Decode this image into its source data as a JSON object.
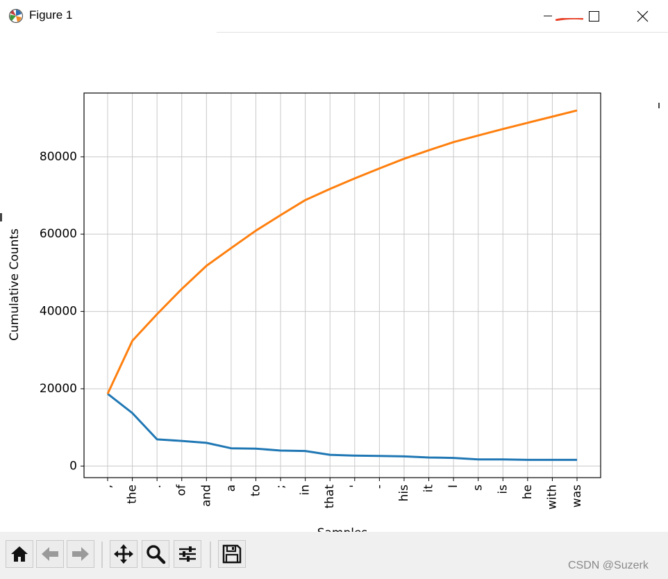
{
  "window": {
    "title": "Figure 1",
    "minimize_icon": "minimize-icon",
    "maximize_icon": "maximize-icon",
    "close_icon": "close-icon"
  },
  "colors": {
    "series_1": "#1f77b4",
    "series_2": "#ff7f0e",
    "grid": "#c8c8c8"
  },
  "toolbar": {
    "buttons": [
      "home-icon",
      "back-arrow-icon",
      "forward-arrow-icon",
      "pan-icon",
      "zoom-icon",
      "configure-subplots-icon",
      "save-icon"
    ]
  },
  "watermark": "CSDN @Suzerk",
  "chart_data": {
    "type": "line",
    "title": "",
    "xlabel": "Samples",
    "ylabel": "Cumulative Counts",
    "categories": [
      ",",
      "the",
      ".",
      "of",
      "and",
      "a",
      "to",
      ";",
      "in",
      "that",
      "'",
      "-",
      "his",
      "it",
      "I",
      "s",
      "is",
      "he",
      "with",
      "was"
    ],
    "ylim": [
      -3000,
      96500
    ],
    "yticks": [
      0,
      20000,
      40000,
      60000,
      80000
    ],
    "ytick_labels": [
      "0",
      "20000",
      "40000",
      "60000",
      "80000"
    ],
    "grid": true,
    "series": [
      {
        "color": "#1f77b4",
        "values": [
          18700,
          13700,
          6900,
          6500,
          6000,
          4600,
          4500,
          4000,
          3900,
          2900,
          2700,
          2600,
          2500,
          2200,
          2100,
          1700,
          1700,
          1600,
          1600,
          1600
        ]
      },
      {
        "color": "#ff7f0e",
        "values": [
          18700,
          32400,
          39300,
          45800,
          51800,
          56400,
          60900,
          64900,
          68800,
          71700,
          74400,
          77000,
          79500,
          81700,
          83800,
          85500,
          87200,
          88800,
          90400,
          92000
        ]
      }
    ]
  }
}
